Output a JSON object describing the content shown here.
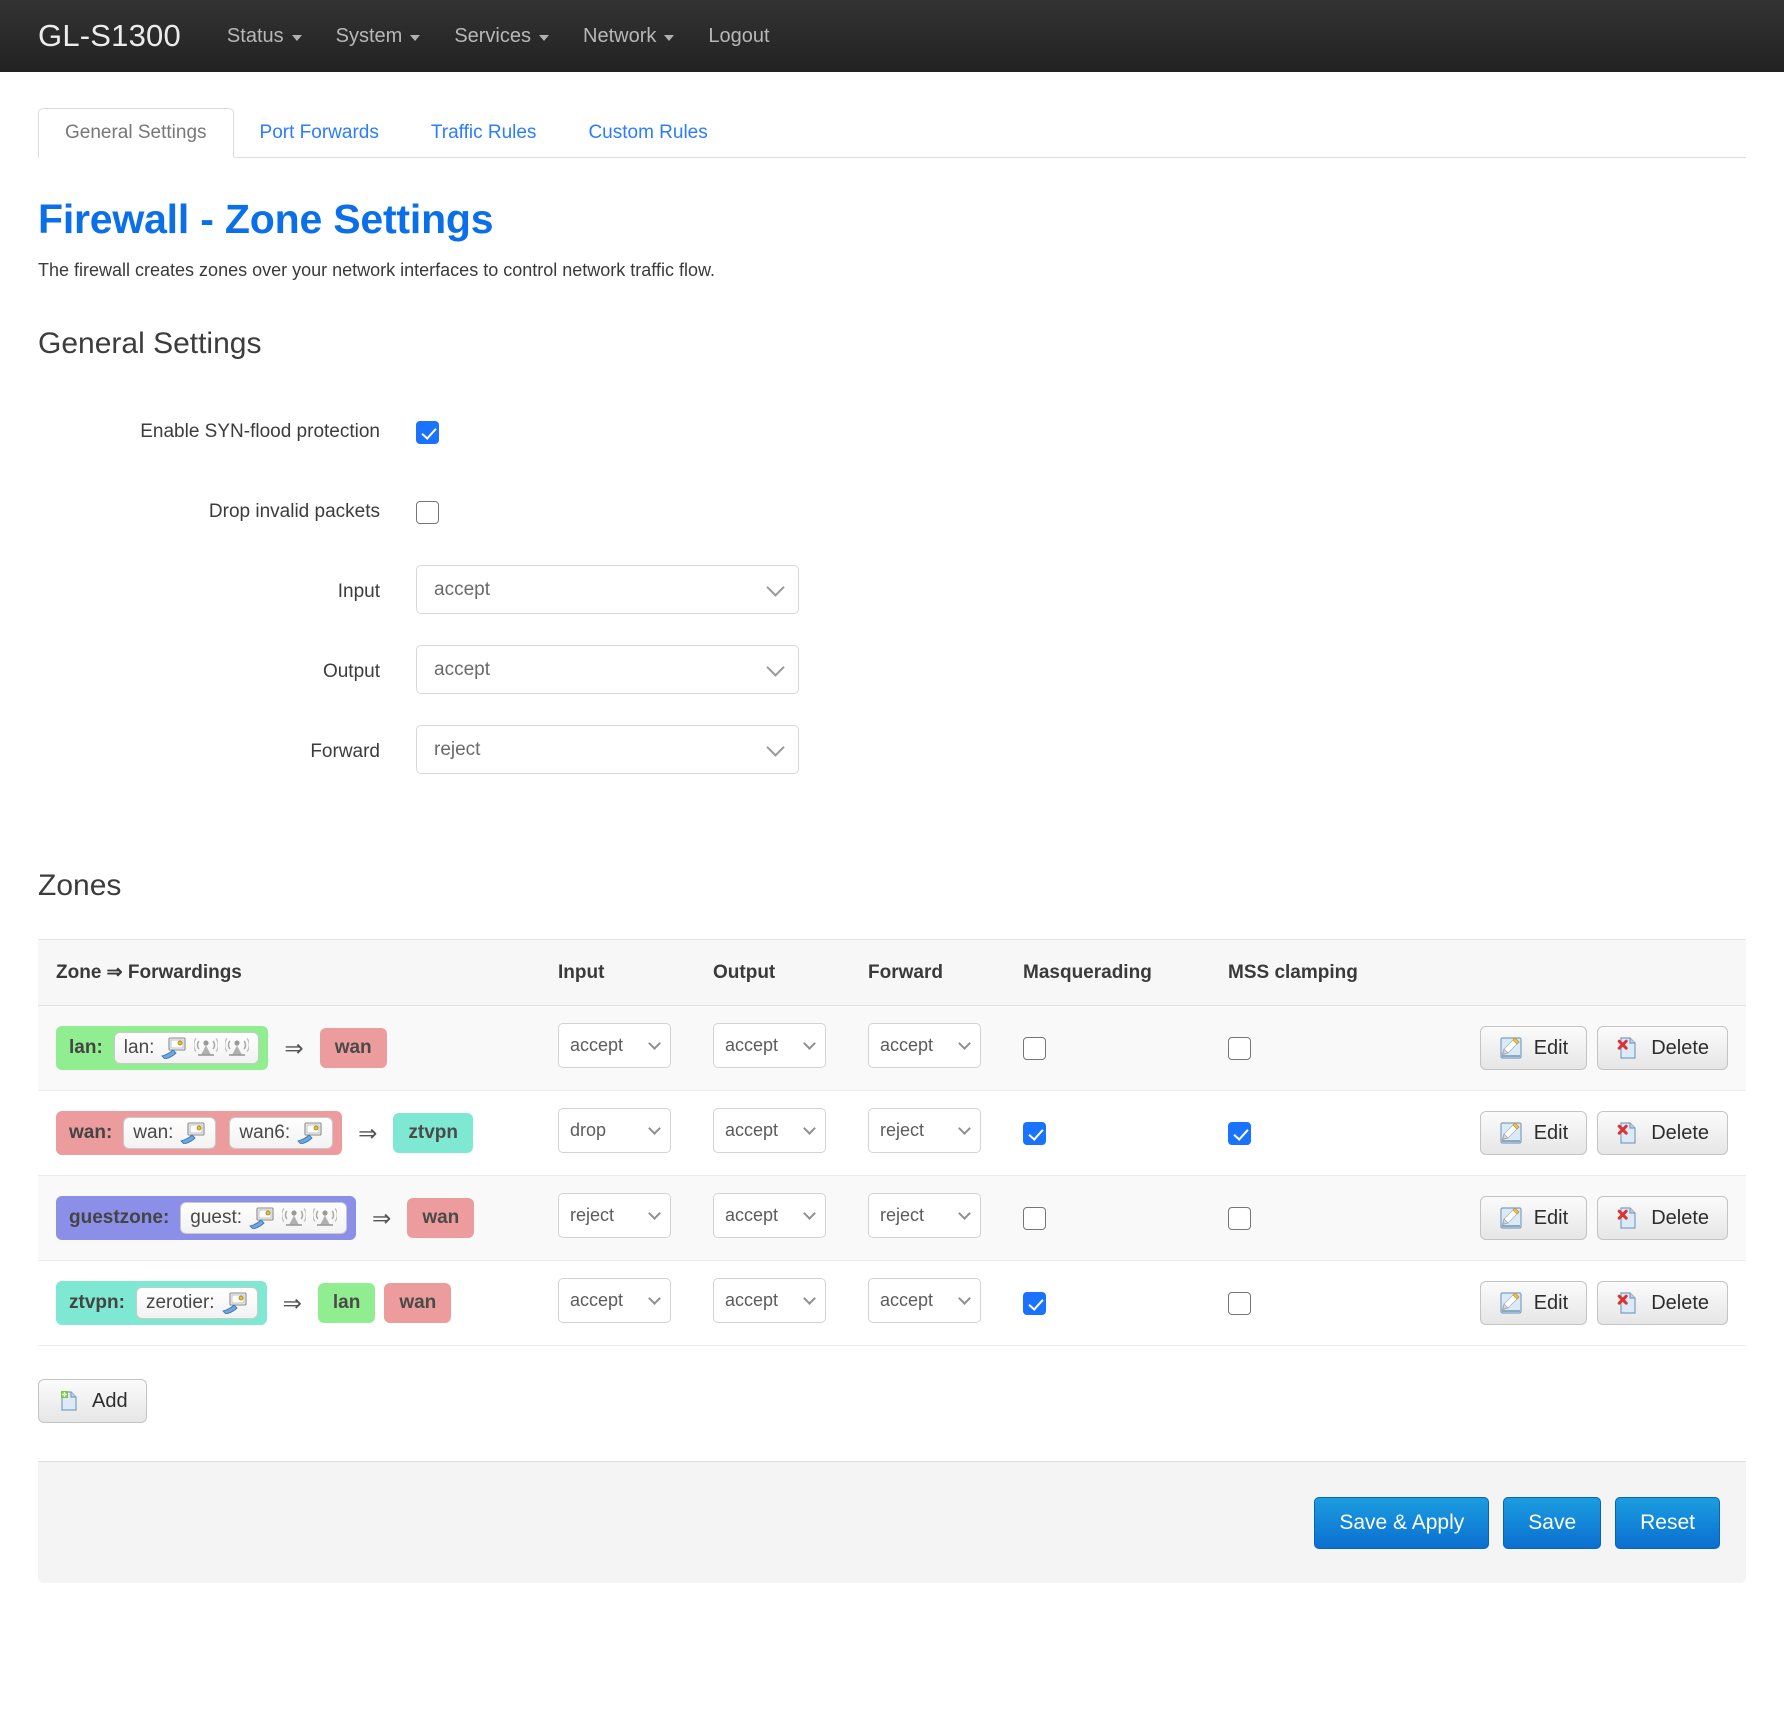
{
  "navbar": {
    "brand": "GL-S1300",
    "items": [
      {
        "label": "Status",
        "caret": true,
        "icon": "chevron-down-icon"
      },
      {
        "label": "System",
        "caret": true,
        "icon": "chevron-down-icon"
      },
      {
        "label": "Services",
        "caret": true,
        "icon": "chevron-down-icon"
      },
      {
        "label": "Network",
        "caret": true,
        "icon": "chevron-down-icon"
      },
      {
        "label": "Logout",
        "caret": false,
        "icon": ""
      }
    ]
  },
  "tabs": [
    {
      "label": "General Settings",
      "active": true
    },
    {
      "label": "Port Forwards",
      "active": false
    },
    {
      "label": "Traffic Rules",
      "active": false
    },
    {
      "label": "Custom Rules",
      "active": false
    }
  ],
  "page": {
    "title": "Firewall - Zone Settings",
    "description": "The firewall creates zones over your network interfaces to control network traffic flow.",
    "section_title": "General Settings",
    "zones_title": "Zones"
  },
  "general_settings": {
    "syn_flood": {
      "label": "Enable SYN-flood protection",
      "checked": true
    },
    "drop_invalid": {
      "label": "Drop invalid packets",
      "checked": false
    },
    "input": {
      "label": "Input",
      "value": "accept"
    },
    "output": {
      "label": "Output",
      "value": "accept"
    },
    "forward": {
      "label": "Forward",
      "value": "reject"
    },
    "policy_options": [
      "accept",
      "reject",
      "drop"
    ]
  },
  "zones_table": {
    "headers": {
      "zone": "Zone ⇒ Forwardings",
      "input": "Input",
      "output": "Output",
      "forward": "Forward",
      "masquerading": "Masquerading",
      "mss_clamping": "MSS clamping"
    },
    "rows": [
      {
        "zone_name": "lan:",
        "zone_color": "z-green",
        "interfaces": [
          {
            "label": "lan:",
            "icons": [
              "ethernet-icon",
              "wifi-icon",
              "wifi-icon"
            ]
          }
        ],
        "arrow": "⇒",
        "destinations": [
          {
            "label": "wan",
            "color": "z-red"
          }
        ],
        "input": "accept",
        "output": "accept",
        "forward": "accept",
        "masquerading": false,
        "mss_clamping": false,
        "edit_label": "Edit",
        "delete_label": "Delete"
      },
      {
        "zone_name": "wan:",
        "zone_color": "z-red",
        "interfaces": [
          {
            "label": "wan:",
            "icons": [
              "ethernet-icon"
            ]
          },
          {
            "label": "wan6:",
            "icons": [
              "ethernet-icon"
            ]
          }
        ],
        "arrow": "⇒",
        "destinations": [
          {
            "label": "ztvpn",
            "color": "z-teal"
          }
        ],
        "input": "drop",
        "output": "accept",
        "forward": "reject",
        "masquerading": true,
        "mss_clamping": true,
        "edit_label": "Edit",
        "delete_label": "Delete"
      },
      {
        "zone_name": "guestzone:",
        "zone_color": "z-blue",
        "interfaces": [
          {
            "label": "guest:",
            "icons": [
              "ethernet-icon",
              "wifi-icon",
              "wifi-icon"
            ]
          }
        ],
        "arrow": "⇒",
        "destinations": [
          {
            "label": "wan",
            "color": "z-red"
          }
        ],
        "input": "reject",
        "output": "accept",
        "forward": "reject",
        "masquerading": false,
        "mss_clamping": false,
        "edit_label": "Edit",
        "delete_label": "Delete"
      },
      {
        "zone_name": "ztvpn:",
        "zone_color": "z-teal",
        "interfaces": [
          {
            "label": "zerotier:",
            "icons": [
              "ethernet-icon"
            ]
          }
        ],
        "arrow": "⇒",
        "destinations": [
          {
            "label": "lan",
            "color": "z-green"
          },
          {
            "label": "wan",
            "color": "z-red"
          }
        ],
        "input": "accept",
        "output": "accept",
        "forward": "accept",
        "masquerading": true,
        "mss_clamping": false,
        "edit_label": "Edit",
        "delete_label": "Delete"
      }
    ],
    "add_label": "Add"
  },
  "footer": {
    "save_apply_label": "Save & Apply",
    "save_label": "Save",
    "reset_label": "Reset"
  },
  "colors": {
    "accent_blue": "#0a6fe8",
    "link_blue": "#2b7cff",
    "checkbox_blue": "#1a73ff",
    "zone_lan_green": "#90ee90",
    "zone_wan_red": "#ec9c9c",
    "zone_guest_blue": "#8b8fe8",
    "zone_ztvpn_teal": "#7ee8d2",
    "navbar_dark": "#2b2b2b"
  }
}
